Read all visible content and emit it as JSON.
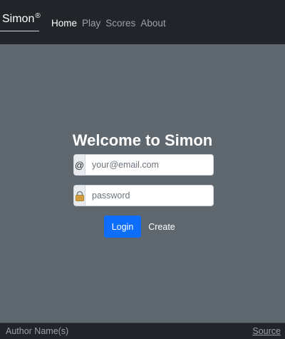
{
  "header": {
    "brand": "Simon",
    "brand_mark": "®",
    "nav": [
      "Home",
      "Play",
      "Scores",
      "About"
    ]
  },
  "main": {
    "title": "Welcome to Simon",
    "email": {
      "prefix": "@",
      "placeholder": "your@email.com"
    },
    "password": {
      "prefix_icon": "lock-icon",
      "placeholder": "password"
    },
    "login_label": "Login",
    "create_label": "Create"
  },
  "footer": {
    "author": "Author Name(s)",
    "source": "Source"
  },
  "colors": {
    "navbar": "#212529",
    "background": "#5f676f",
    "primary": "#0d6efd"
  }
}
